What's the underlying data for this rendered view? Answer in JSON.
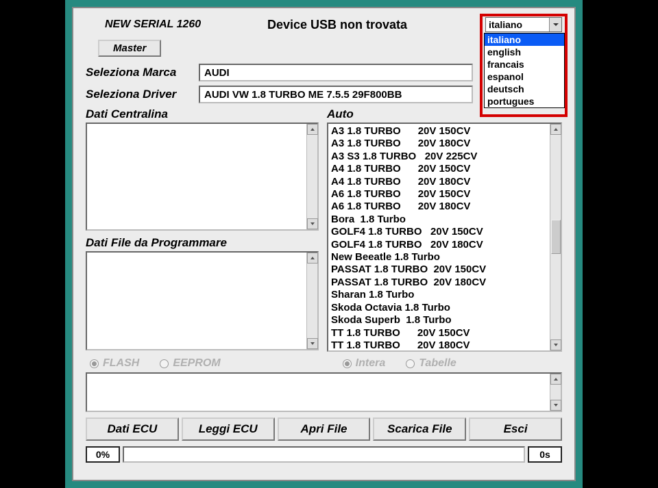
{
  "header": {
    "serial": "NEW SERIAL 1260",
    "device_status": "Device USB non trovata"
  },
  "language": {
    "selected": "italiano",
    "options": [
      "italiano",
      "english",
      "francais",
      "espanol",
      "deutsch",
      "portugues"
    ]
  },
  "buttons": {
    "master": "Master",
    "dati_ecu": "Dati ECU",
    "leggi_ecu": "Leggi ECU",
    "apri_file": "Apri File",
    "scarica_file": "Scarica File",
    "esci": "Esci"
  },
  "labels": {
    "seleziona_marca": "Seleziona Marca",
    "seleziona_driver": "Seleziona Driver",
    "dati_centralina": "Dati Centralina",
    "dati_file": "Dati File da Programmare",
    "auto": "Auto"
  },
  "fields": {
    "marca": "AUDI",
    "driver": "AUDI VW 1.8 TURBO ME 7.5.5 29F800BB"
  },
  "radios": {
    "flash": "FLASH",
    "eeprom": "EEPROM",
    "intera": "Intera",
    "tabelle": "Tabelle"
  },
  "auto_list": [
    "A3 1.8 TURBO      20V 150CV",
    "A3 1.8 TURBO      20V 180CV",
    "A3 S3 1.8 TURBO   20V 225CV",
    "A4 1.8 TURBO      20V 150CV",
    "A4 1.8 TURBO      20V 180CV",
    "A6 1.8 TURBO      20V 150CV",
    "A6 1.8 TURBO      20V 180CV",
    "Bora  1.8 Turbo",
    "GOLF4 1.8 TURBO   20V 150CV",
    "GOLF4 1.8 TURBO   20V 180CV",
    "New Beeatle 1.8 Turbo",
    "PASSAT 1.8 TURBO  20V 150CV",
    "PASSAT 1.8 TURBO  20V 180CV",
    "Sharan 1.8 Turbo",
    "Skoda Octavia 1.8 Turbo",
    "Skoda Superb  1.8 Turbo",
    "TT 1.8 TURBO      20V 150CV",
    "TT 1.8 TURBO      20V 180CV"
  ],
  "progress": {
    "percent": "0%",
    "time": "0s"
  }
}
